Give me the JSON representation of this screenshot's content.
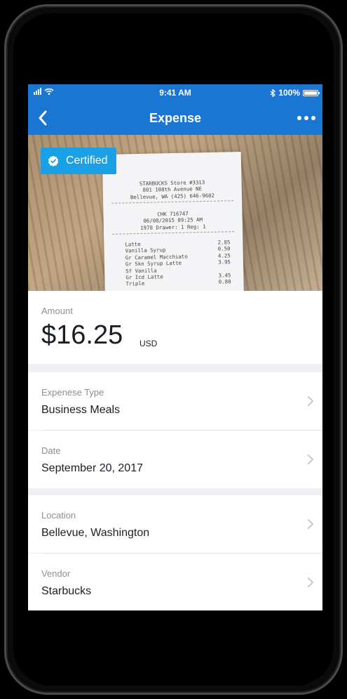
{
  "status_bar": {
    "time": "9:41 AM",
    "battery": "100%"
  },
  "nav": {
    "title": "Expense"
  },
  "badge": {
    "label": "Certified"
  },
  "receipt": {
    "lines_header": [
      "STARBUCKS Store #3313",
      "801 108th Avenue NE",
      "Bellevue, WA (425) 646-9602"
    ],
    "lines_mid": [
      "CHK 716747",
      "06/08/2015 09:25 AM",
      "1978  Drawer: 1  Reg: 1"
    ],
    "items": [
      {
        "name": "Latte",
        "price": "2.85"
      },
      {
        "name": "Vanilla Syrup",
        "price": "0.50"
      },
      {
        "name": "Gr Caramel Macchiato",
        "price": "4.25"
      },
      {
        "name": "Gr Skn Syrup Latte",
        "price": "3.95"
      },
      {
        "name": "Sf Vanilla",
        "price": ""
      },
      {
        "name": "Gr Icd Latte",
        "price": "3.45"
      },
      {
        "name": "Triple",
        "price": "0.80"
      }
    ]
  },
  "amount": {
    "label": "Amount",
    "value": "$16.25",
    "currency": "USD"
  },
  "fields": {
    "expense_type": {
      "label": "Expenese Type",
      "value": "Business Meals"
    },
    "date": {
      "label": "Date",
      "value": "September 20, 2017"
    },
    "location": {
      "label": "Location",
      "value": "Bellevue, Washington"
    },
    "vendor": {
      "label": "Vendor",
      "value": "Starbucks"
    }
  },
  "colors": {
    "brand": "#1976d2",
    "badge": "#1ba0e5",
    "background": "#eef0f3"
  }
}
